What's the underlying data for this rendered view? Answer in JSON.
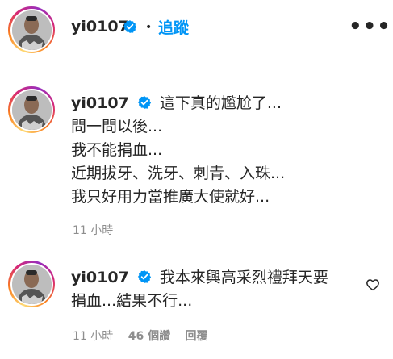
{
  "header": {
    "username": "yi0107",
    "separator": "•",
    "follow_label": "追蹤",
    "more_label": "•••",
    "avatar_icon": "profile-avatar",
    "verified_icon": "verified-badge-icon"
  },
  "caption": {
    "username": "yi0107",
    "lines": [
      "這下真的尷尬了...",
      "問一問以後...",
      "我不能捐血...",
      "近期拔牙、洗牙、刺青、入珠...",
      "我只好用力當推廣大使就好..."
    ],
    "time": "11 小時"
  },
  "comment": {
    "username": "yi0107",
    "lines": [
      "我本來興高采烈禮拜天要",
      "捐血...結果不行..."
    ],
    "time": "11 小時",
    "likes": "46 個讚",
    "reply_label": "回覆",
    "heart_icon": "heart-outline-icon"
  },
  "colors": {
    "link_blue": "#0095f6",
    "verified_blue": "#0095f6",
    "text": "#262626",
    "muted": "#8e8e8e"
  }
}
